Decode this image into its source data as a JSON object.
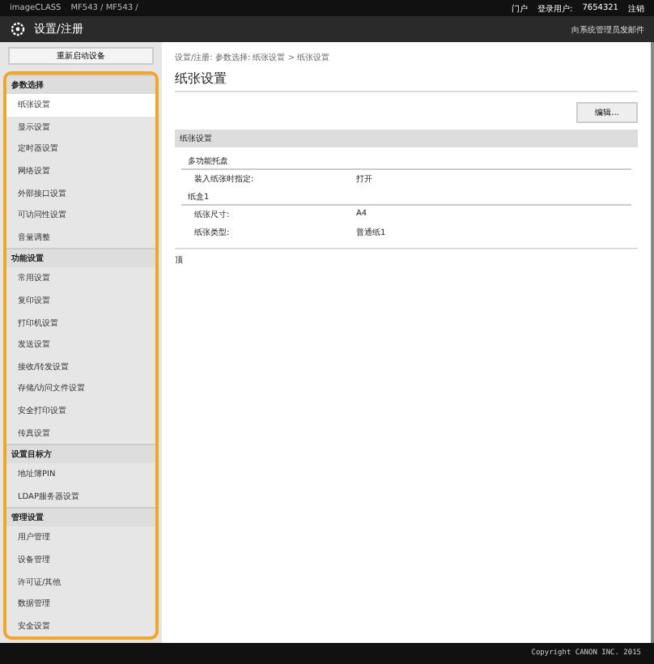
{
  "top_bar": {
    "device": "imageCLASS",
    "address": "MF543 / MF543 /",
    "links": [
      {
        "label": "门户"
      },
      {
        "label": "登录用户:"
      }
    ],
    "user": "7654321",
    "logout": "注销"
  },
  "header": {
    "title": "设置/注册",
    "mail_link": "向系统管理员发邮件"
  },
  "sidebar": {
    "restart_button": "重新启动设备",
    "sections": [
      {
        "title": "参数选择",
        "items": [
          {
            "label": "纸张设置",
            "selected": true
          },
          {
            "label": "显示设置",
            "selected": false
          },
          {
            "label": "定时器设置",
            "selected": false
          },
          {
            "label": "网络设置",
            "selected": false
          },
          {
            "label": "外部接口设置",
            "selected": false
          },
          {
            "label": "可访问性设置",
            "selected": false
          },
          {
            "label": "音量调整",
            "selected": false
          }
        ]
      },
      {
        "title": "功能设置",
        "items": [
          {
            "label": "常用设置",
            "selected": false
          },
          {
            "label": "复印设置",
            "selected": false
          },
          {
            "label": "打印机设置",
            "selected": false
          },
          {
            "label": "发送设置",
            "selected": false
          },
          {
            "label": "接收/转发设置",
            "selected": false
          },
          {
            "label": "存储/访问文件设置",
            "selected": false
          },
          {
            "label": "安全打印设置",
            "selected": false
          },
          {
            "label": "传真设置",
            "selected": false
          }
        ]
      },
      {
        "title": "设置目标方",
        "items": [
          {
            "label": "地址簿PIN",
            "selected": false
          },
          {
            "label": "LDAP服务器设置",
            "selected": false
          }
        ]
      },
      {
        "title": "管理设置",
        "items": [
          {
            "label": "用户管理",
            "selected": false
          },
          {
            "label": "设备管理",
            "selected": false
          },
          {
            "label": "许可证/其他",
            "selected": false
          },
          {
            "label": "数据管理",
            "selected": false
          },
          {
            "label": "安全设置",
            "selected": false
          }
        ]
      }
    ]
  },
  "main": {
    "breadcrumb": "设置/注册: 参数选择: 纸张设置 > 纸张设置",
    "title": "纸张设置",
    "edit_button": "编辑...",
    "section_title": "纸张设置",
    "groups": [
      {
        "title": "多功能托盘",
        "rows": [
          {
            "label": "装入纸张时指定:",
            "value": "打开"
          }
        ]
      },
      {
        "title": "纸盒1",
        "rows": [
          {
            "label": "纸张尺寸:",
            "value": "A4"
          },
          {
            "label": "纸张类型:",
            "value": "普通纸1"
          }
        ]
      }
    ],
    "top_link": "顶"
  },
  "footer": {
    "copyright": "Copyright CANON INC. 2015"
  }
}
